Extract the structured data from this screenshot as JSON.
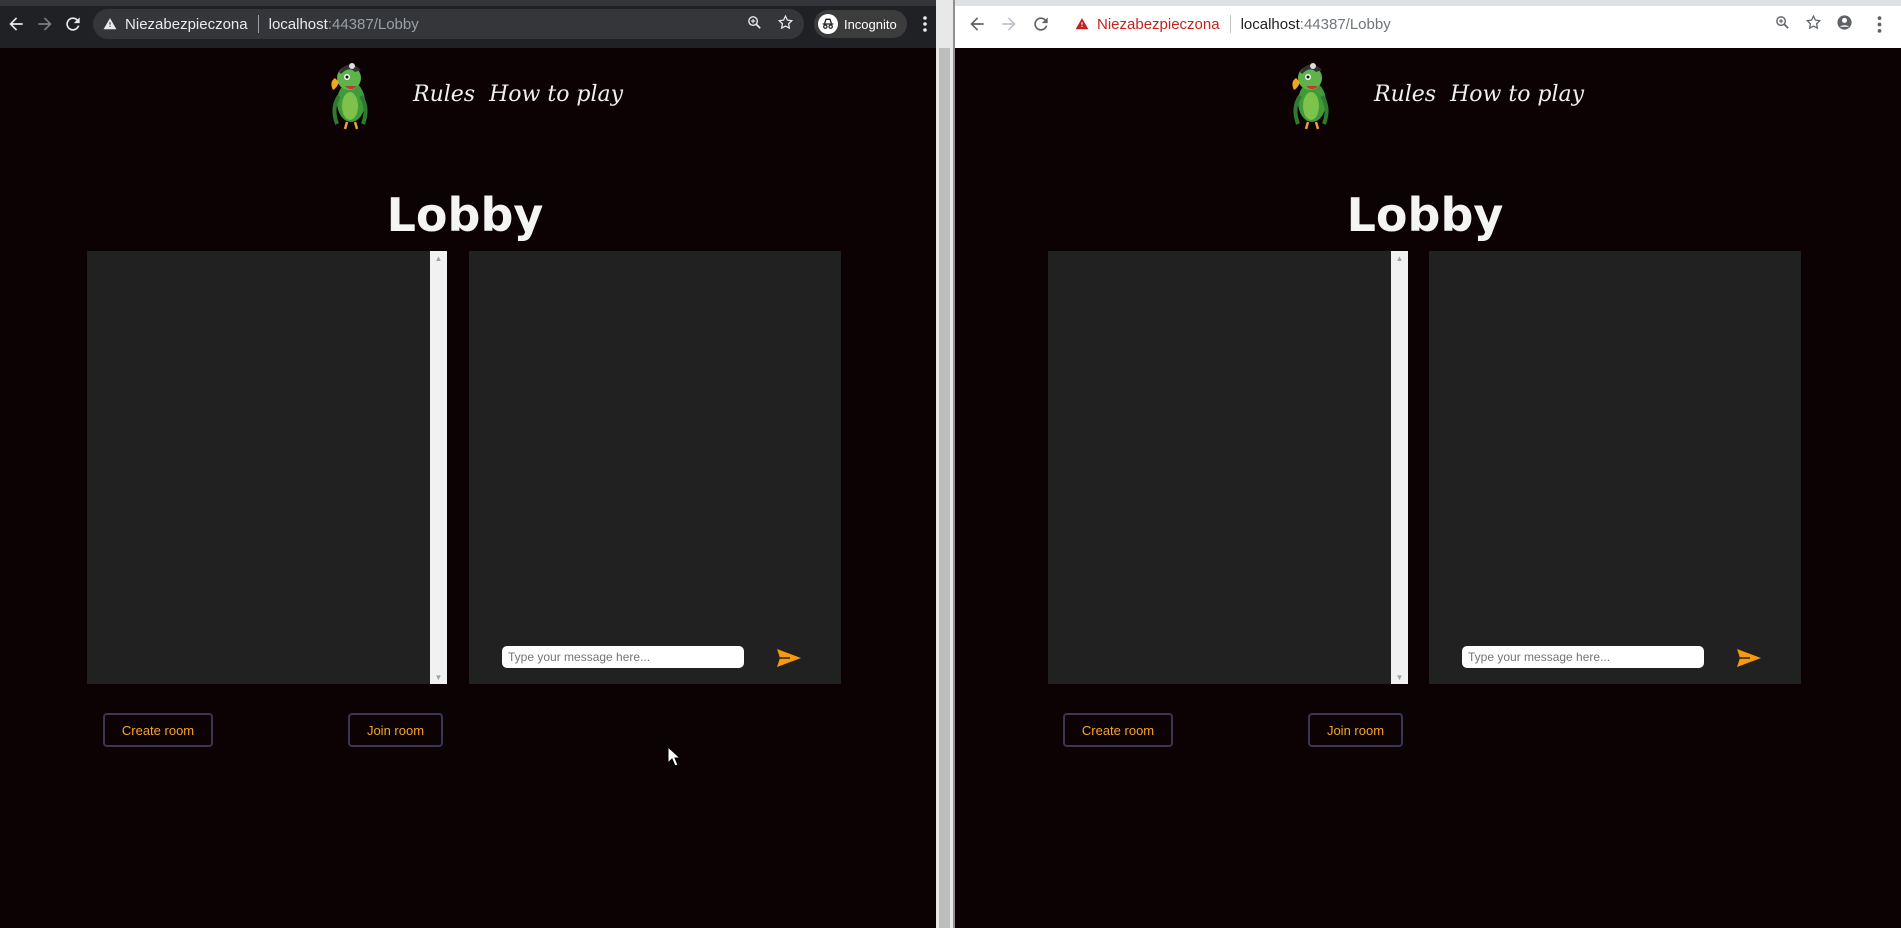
{
  "windows": [
    {
      "id": "incognito",
      "theme": "dark",
      "address": {
        "security_label": "Niezabezpieczona",
        "host": "localhost",
        "path": ":44387/Lobby"
      },
      "profile_label": "Incognito"
    },
    {
      "id": "normal",
      "theme": "light",
      "address": {
        "security_label": "Niezabezpieczona",
        "host": "localhost",
        "path": ":44387/Lobby"
      }
    }
  ],
  "site": {
    "nav": {
      "rules": "Rules",
      "how_to_play": "How to play"
    },
    "title": "Lobby",
    "chat": {
      "placeholder": "Type your message here..."
    },
    "buttons": {
      "create_room": "Create room",
      "join_room": "Join room"
    }
  },
  "colors": {
    "page_bg": "#0d0203",
    "panel_bg": "#212121",
    "accent": "#f5a52c",
    "button_border": "#3a3552",
    "insecure_red": "#c5221f"
  },
  "icons": [
    "back-arrow-icon",
    "forward-arrow-icon",
    "reload-icon",
    "warning-icon",
    "zoom-icon",
    "star-icon",
    "incognito-icon",
    "account-icon",
    "menu-dots-icon",
    "parrot-logo",
    "send-icon",
    "mouse-cursor-icon"
  ]
}
